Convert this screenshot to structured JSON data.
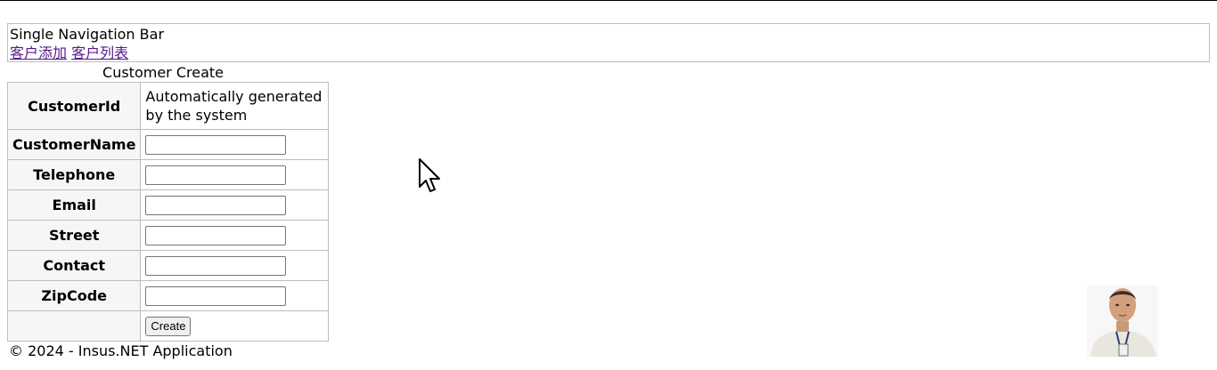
{
  "nav": {
    "title": "Single Navigation Bar",
    "links": [
      {
        "label": "客户添加"
      },
      {
        "label": "客户列表"
      }
    ]
  },
  "form": {
    "caption": "Customer Create",
    "rows": [
      {
        "label": "CustomerId",
        "value": "Automatically generated by the system"
      },
      {
        "label": "CustomerName",
        "value": ""
      },
      {
        "label": "Telephone",
        "value": ""
      },
      {
        "label": "Email",
        "value": ""
      },
      {
        "label": "Street",
        "value": ""
      },
      {
        "label": "Contact",
        "value": ""
      },
      {
        "label": "ZipCode",
        "value": ""
      }
    ],
    "submit_label": "Create"
  },
  "footer": {
    "text": "© 2024 - Insus.NET Application"
  },
  "overlay": {
    "cursor_icon": "pointer-arrow-icon",
    "webcam": "presenter-webcam"
  }
}
